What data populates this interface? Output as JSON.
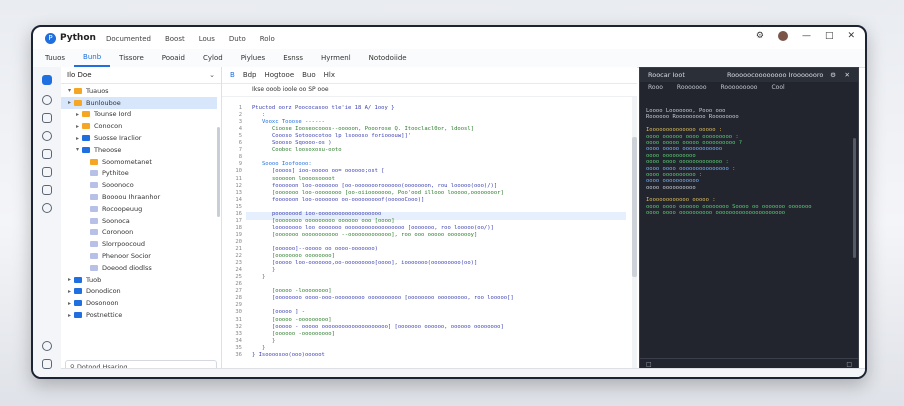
{
  "titlebar": {
    "app_name": "Python",
    "menu": [
      "Documented",
      "Boost",
      "Lous",
      "Duto",
      "Rolo"
    ]
  },
  "tabs": [
    "Tuuos",
    "Bunb",
    "Tissore",
    "Pooaid",
    "Cylod",
    "Piylues",
    "Esnss",
    "Hyrmenl",
    "Notodoiide"
  ],
  "explorer": {
    "header": "Ilo Doe",
    "search_placeholder": "Dotood Hsaring",
    "items": [
      {
        "label": "Tuauos",
        "depth": 0,
        "expanded": true,
        "color": "#f5a623",
        "selected": false
      },
      {
        "label": "Bunlouboe",
        "depth": 0,
        "expanded": false,
        "color": "#f5a623",
        "selected": true
      },
      {
        "label": "Tounse Iord",
        "depth": 1,
        "expanded": false,
        "color": "#f5a623",
        "selected": false
      },
      {
        "label": "Conocon",
        "depth": 1,
        "expanded": false,
        "color": "#f5a623",
        "selected": false
      },
      {
        "label": "Suosse Iraclior",
        "depth": 1,
        "expanded": false,
        "color": "#1f6fe0",
        "selected": false
      },
      {
        "label": "Theoose",
        "depth": 1,
        "expanded": true,
        "color": "#1f6fe0",
        "selected": false
      },
      {
        "label": "Soomometanet",
        "depth": 2,
        "expanded": false,
        "color": "#f5a623",
        "selected": false
      },
      {
        "label": "Pythitoe",
        "depth": 2,
        "expanded": false,
        "color": "#b7c1e8",
        "selected": false
      },
      {
        "label": "Sooonoco",
        "depth": 2,
        "expanded": false,
        "color": "#b7c1e8",
        "selected": false
      },
      {
        "label": "Boooou Ihraanhor",
        "depth": 2,
        "expanded": false,
        "color": "#b7c1e8",
        "selected": false
      },
      {
        "label": "Rocoopeuug",
        "depth": 2,
        "expanded": false,
        "color": "#b7c1e8",
        "selected": false
      },
      {
        "label": "Soonoca",
        "depth": 2,
        "expanded": false,
        "color": "#b7c1e8",
        "selected": false
      },
      {
        "label": "Coronoon",
        "depth": 2,
        "expanded": false,
        "color": "#b7c1e8",
        "selected": false
      },
      {
        "label": "Slorrpoocoud",
        "depth": 2,
        "expanded": false,
        "color": "#b7c1e8",
        "selected": false
      },
      {
        "label": "Phenoor Socior",
        "depth": 2,
        "expanded": false,
        "color": "#b7c1e8",
        "selected": false
      },
      {
        "label": "Doeood diodlss",
        "depth": 2,
        "expanded": false,
        "color": "#b7c1e8",
        "selected": false
      },
      {
        "label": "Tuob",
        "depth": 0,
        "expanded": false,
        "color": "#1f6fe0",
        "selected": false
      },
      {
        "label": "Donodicon",
        "depth": 0,
        "expanded": false,
        "color": "#1f6fe0",
        "selected": false
      },
      {
        "label": "Dosonoon",
        "depth": 0,
        "expanded": false,
        "color": "#1f6fe0",
        "selected": false
      },
      {
        "label": "Postnettice",
        "depth": 0,
        "expanded": false,
        "color": "#1f6fe0",
        "selected": false
      }
    ]
  },
  "editor": {
    "toolbar": [
      "B",
      "Bdp",
      "Hogtooe",
      "Buo",
      "Hlx"
    ],
    "breadcrumb": "Ikse   ooob   ioole   oo   SP   ooe",
    "lines": [
      {
        "n": "1",
        "text": "Ptuctod oorz Poococasoo  tle'ie 18  A/  1ooy  }",
        "indent": 0,
        "color": "#3a3fb0"
      },
      {
        "n": "2",
        "text": ":",
        "indent": 1,
        "color": "#666"
      },
      {
        "n": "3",
        "text": "Vooxc Tooose  ------",
        "indent": 1,
        "color": "#1f6fe0"
      },
      {
        "n": "4",
        "text": "Cioose Iooseocooos--ooooon, Pooorose Q.  Itooclacl0or, ldoosl]",
        "indent": 2,
        "color": "#2a7a2a"
      },
      {
        "n": "5",
        "text": "Coooso  Sotooocotoo  lp  lsoooso  foriooouw]]'",
        "indent": 2,
        "color": "#3a3fb0"
      },
      {
        "n": "6",
        "text": "Soooso  Sqoooo-os  )",
        "indent": 2,
        "color": "#3a3fb0"
      },
      {
        "n": "7",
        "text": "Cooboc  loosoxosu-ooto",
        "indent": 2,
        "color": "#2a7a2a"
      },
      {
        "n": "8",
        "text": "",
        "indent": 0,
        "color": "#666"
      },
      {
        "n": "9",
        "text": "Soooo  Ioofoooo:",
        "indent": 1,
        "color": "#1f6fe0"
      },
      {
        "n": "10",
        "text": "[oooos]  ioo-ooooo  oo=  oooooo;ost  [",
        "indent": 2,
        "color": "#3a3fb0"
      },
      {
        "n": "11",
        "text": "sooooon  loooosoooot",
        "indent": 2,
        "color": "#2a7a2a"
      },
      {
        "n": "12",
        "text": "foooooon  loo-ooooooo  [oo-oooooooroooooo(ooooooon,  rou  looooo(ooo)/)]",
        "indent": 2,
        "color": "#3a3fb0"
      },
      {
        "n": "13",
        "text": "[ooooooo  loo-oooooooo  [oo-oiiooooooo,  Poo'ood  illooo  looooo,oooooooor]",
        "indent": 2,
        "color": "#2a7a2a"
      },
      {
        "n": "14",
        "text": "foooooon  loo-ooooooo  oo-ooooooooof(oooooCooo)]",
        "indent": 2,
        "color": "#3a3fb0"
      },
      {
        "n": "15",
        "text": "",
        "indent": 0,
        "color": "#666"
      },
      {
        "n": "16",
        "text": "poooooood  ioo-ooooooooooooooooooo",
        "indent": 2,
        "color": "#3a3fb0"
      },
      {
        "n": "17",
        "text": "[oooooooo  ooooooooo  oooooo  ooo  [oooo]",
        "indent": 2,
        "color": "#2a7a2a"
      },
      {
        "n": "18",
        "text": "loooooooo  loo  ooooooo  oooooooooooooooooo  [ooooooo,  roo  looooo(oo/)]",
        "indent": 2,
        "color": "#3a3fb0"
      },
      {
        "n": "19",
        "text": "[ooooooo  ooooooooooo  --ooooooooooooo],  roo  ooo  ooooo  oooooooy]",
        "indent": 2,
        "color": "#2a7a2a"
      },
      {
        "n": "20",
        "text": "",
        "indent": 0,
        "color": "#666"
      },
      {
        "n": "21",
        "text": "[oooooo]--ooooo  oo  oooo-ooooooo)",
        "indent": 2,
        "color": "#3a3fb0"
      },
      {
        "n": "22",
        "text": "[oooooooo  oooooooo]",
        "indent": 2,
        "color": "#2a7a2a"
      },
      {
        "n": "23",
        "text": "[ooooo  loo-ooooooo,oo-ooooooooo[oooo],  iooooooo(ooooooooo(oo)]",
        "indent": 2,
        "color": "#3a3fb0"
      },
      {
        "n": "24",
        "text": "}",
        "indent": 2,
        "color": "#666"
      },
      {
        "n": "25",
        "text": "}",
        "indent": 1,
        "color": "#666"
      },
      {
        "n": "26",
        "text": "",
        "indent": 0,
        "color": "#666"
      },
      {
        "n": "27",
        "text": "[ooooo  -loooooooo]",
        "indent": 2,
        "color": "#2a7a2a"
      },
      {
        "n": "28",
        "text": "[oooooooo  oooo-ooo-ooooooooo  oooooooooo  [oooooooo  ooooooooo,  roo  looooo[]",
        "indent": 2,
        "color": "#3a3fb0"
      },
      {
        "n": "29",
        "text": "",
        "indent": 0,
        "color": "#666"
      },
      {
        "n": "30",
        "text": "[ooooo  ]  -",
        "indent": 2,
        "color": "#3a3fb0"
      },
      {
        "n": "31",
        "text": "[ooooo  -ooooooooo]",
        "indent": 2,
        "color": "#2a7a2a"
      },
      {
        "n": "32",
        "text": "[ooooo  -  ooooo  oooooooooooooooooooo]  [ooooooo  oooooo,  oooooo  oooooooo]",
        "indent": 2,
        "color": "#3a3fb0"
      },
      {
        "n": "33",
        "text": "[oooooo  -ooooooooo]",
        "indent": 2,
        "color": "#2a7a2a"
      },
      {
        "n": "34",
        "text": "}",
        "indent": 2,
        "color": "#666"
      },
      {
        "n": "35",
        "text": "}",
        "indent": 1,
        "color": "#666"
      },
      {
        "n": "36",
        "text": "}  Isoooosoo(ooo)ooooot",
        "indent": 0,
        "color": "#3a3fb0"
      }
    ]
  },
  "terminal": {
    "title": "Roocar Ioot",
    "subtitle": "Rooooocoooooooo  Irooooooro",
    "tabs": [
      "Rooo",
      "Rooooooo",
      "Rooooooooo",
      "Cool"
    ],
    "lines": [
      {
        "text": "Loooo   Looooooo,  Pooo   ooo",
        "color": "#c9ced6"
      },
      {
        "text": "Roooooo  Rooooooooo  Roooooooo",
        "color": "#c9ced6"
      },
      {
        "text": "",
        "color": "#c9ced6"
      },
      {
        "text": "Ioooooooooooooo  ooooo  :",
        "color": "#e0c060"
      },
      {
        "text": "   oooo  oooooo  oooo  ooooooooo  :",
        "color": "#5fcf7a"
      },
      {
        "text": "   oooo  ooooo  ooooo  oooooooooo  ?",
        "color": "#5fcf7a"
      },
      {
        "text": "   oooo  ooooo  oooooooooooo",
        "color": "#7ab8ff"
      },
      {
        "text": "   oooo  oooooooooo",
        "color": "#5fcf7a"
      },
      {
        "text": "   oooo  oooo  ooooooooooooo  :",
        "color": "#5fcf7a"
      },
      {
        "text": "   oooo  oooo  ooooooooooooooo  :",
        "color": "#7ab8ff"
      },
      {
        "text": "   oooo  oooooooooo  :",
        "color": "#5fcf7a"
      },
      {
        "text": "   oooo  ooooooooooo",
        "color": "#7ab8ff"
      },
      {
        "text": "   oooo  oooooooooo",
        "color": "#c9ced6"
      },
      {
        "text": "",
        "color": "#c9ced6"
      },
      {
        "text": "Ioooooooooooo  ooooo  :",
        "color": "#e0c060"
      },
      {
        "text": "   oooo  oooo  oooooo  oooooooo  Soooo  oo  ooooooo  ooooooo",
        "color": "#5fcf7a"
      },
      {
        "text": "   oooo  oooo  oooooooooo  ooooooooooooooooooooo",
        "color": "#5fcf7a"
      }
    ]
  }
}
